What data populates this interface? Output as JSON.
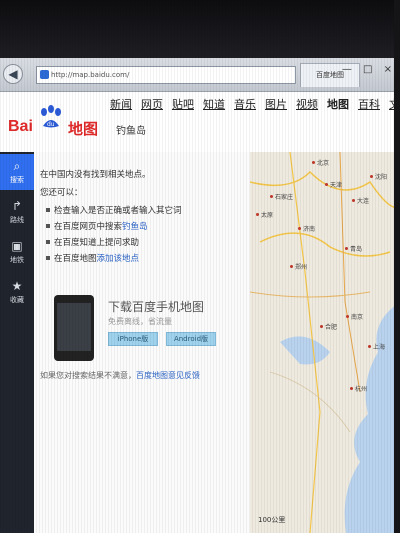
{
  "browser": {
    "address": "http://map.baidu.com/",
    "tab_label": "百度地图",
    "window_controls": "— □ ×"
  },
  "header": {
    "logo_left": "Bai",
    "logo_right": "地图",
    "nav": [
      "新闻",
      "网页",
      "贴吧",
      "知道",
      "音乐",
      "图片",
      "视频",
      "地图",
      "百科",
      "文"
    ],
    "active_nav_index": 7,
    "location": "钓鱼岛"
  },
  "sidebar": {
    "items": [
      {
        "label": "搜索",
        "icon": "search-icon"
      },
      {
        "label": "路线",
        "icon": "route-icon"
      },
      {
        "label": "地铁",
        "icon": "subway-icon"
      },
      {
        "label": "收藏",
        "icon": "star-icon"
      }
    ]
  },
  "results": {
    "title": "在中国内没有找到相关地点。",
    "suggest_heading": "您还可以：",
    "suggestions": [
      {
        "text": "检查输入是否正确或者输入其它词",
        "link": ""
      },
      {
        "text": "在百度网页中搜索",
        "link": "钓鱼岛"
      },
      {
        "text": "在百度知道上提问求助",
        "link": ""
      },
      {
        "text": "在百度地图",
        "link": "添加该地点"
      }
    ],
    "promo_title": "下载百度手机地图",
    "promo_sub": "免费离线，省流量",
    "promo_btn_1": "iPhone版",
    "promo_btn_2": "Android版",
    "feedback": "如果您对搜索结果不满意，",
    "feedback_link": "百度地图意见反馈"
  },
  "map": {
    "cities": [
      "北京",
      "天津",
      "石家庄",
      "太原",
      "济南",
      "大连",
      "沈阳",
      "郑州",
      "青岛",
      "合肥",
      "南京",
      "上海",
      "杭州"
    ],
    "scale": "100公里"
  },
  "colors": {
    "logo_red": "#e12a2a",
    "paw_blue": "#2b5bd7",
    "sidebar_bg": "#20242c",
    "sidebar_active": "#2f6ff0",
    "link": "#2b63c6"
  }
}
